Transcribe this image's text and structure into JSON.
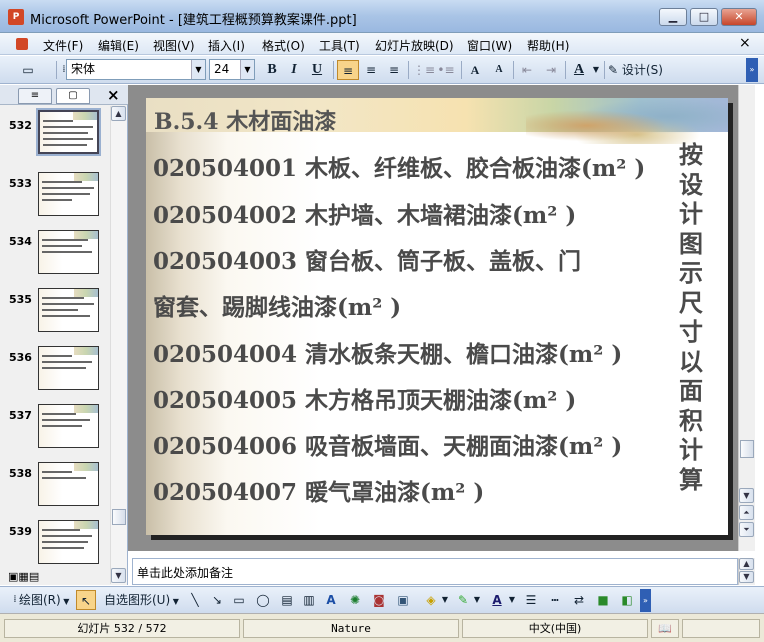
{
  "window": {
    "app_icon_label": "P",
    "title": "Microsoft PowerPoint - [建筑工程概预算教案课件.ppt]",
    "minimize": "▁",
    "maximize": "□",
    "close": "✕"
  },
  "menu": {
    "items": [
      "文件(F)",
      "编辑(E)",
      "视图(V)",
      "插入(I)",
      "格式(O)",
      "工具(T)",
      "幻灯片放映(D)",
      "窗口(W)",
      "帮助(H)"
    ],
    "doc_close": "×"
  },
  "toolbar": {
    "font_name": "宋体",
    "font_size": "24",
    "bold": "B",
    "italic": "I",
    "underline": "U",
    "grow_font": "A",
    "shrink_font": "A",
    "font_color": "A",
    "design": "设计(S)"
  },
  "panel": {
    "outline_tab": "≡",
    "slides_tab": "▢",
    "close": "×",
    "slides": [
      {
        "number": "532",
        "selected": true
      },
      {
        "number": "533"
      },
      {
        "number": "534"
      },
      {
        "number": "535"
      },
      {
        "number": "536"
      },
      {
        "number": "537"
      },
      {
        "number": "538"
      },
      {
        "number": "539"
      }
    ]
  },
  "slide": {
    "title": "B.5.4  木材面油漆",
    "lines": [
      "020504001    木板、纤维板、胶合板油漆(m² )",
      "020504002    木护墙、木墙裙油漆(m² )",
      "020504003   窗台板、筒子板、盖板、门",
      "窗套、踢脚线油漆(m² )",
      "020504004    清水板条天棚、檐口油漆(m² )",
      "020504005    木方格吊顶天棚油漆(m² )",
      "020504006    吸音板墙面、天棚面油漆(m² )",
      "020504007    暖气罩油漆(m² )"
    ],
    "side_note": "按设计图示尺寸以面积计算"
  },
  "notes": {
    "placeholder": "单击此处添加备注"
  },
  "drawing_toolbar": {
    "draw": "绘图(R)",
    "autoshapes": "自选图形(U)"
  },
  "status": {
    "slide_position": "幻灯片 532 / 572",
    "design_template": "Nature",
    "language": "中文(中国)"
  },
  "colors": {
    "titlebar": "#a9c4e6",
    "slide_text": "#4a4a4a",
    "workspace": "#8c8c8c"
  }
}
